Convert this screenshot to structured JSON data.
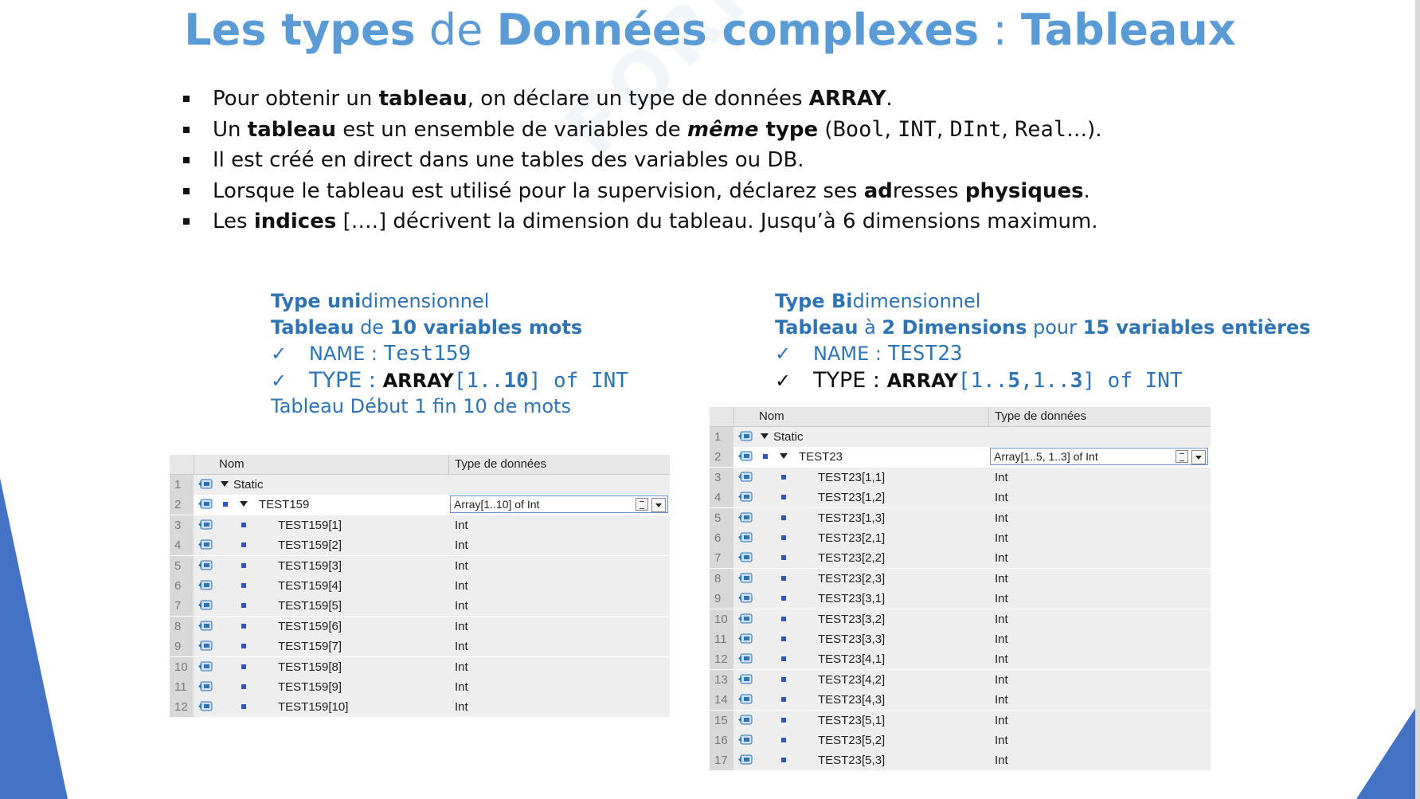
{
  "colors": {
    "title_blue": "#5b9bd5",
    "section_blue": "#2e74b5",
    "decor_blue": "#4472c4"
  },
  "title": {
    "part1": "Les types",
    "part2": " de ",
    "part3": "Données complexes",
    "part4": " : ",
    "part5": "Tableaux"
  },
  "bullets": {
    "b1": {
      "t1": "Pour obtenir un ",
      "t2": "tableau",
      "t3": ", on déclare un type de données ",
      "t4": "ARRAY",
      "t5": "."
    },
    "b2": {
      "t1": "Un ",
      "t2": "tableau",
      "t3": " est un ensemble de variables de ",
      "t4": "même",
      "t5": " type",
      "t6": " (",
      "t7": "Bool",
      "t8": ", ",
      "t9": "INT",
      "t10": ", ",
      "t11": "DInt",
      "t12": ", ",
      "t13": "Real",
      "t14": "…)."
    },
    "b3": {
      "t1": "Il est créé en direct dans une tables des variables ou DB."
    },
    "b4": {
      "t1": "Lorsque le tableau est utilisé pour la supervision, déclarez ses ",
      "t2": "ad",
      "t3": "resses ",
      "t4": "physiques",
      "t5": "."
    },
    "b5": {
      "t1": "Les ",
      "t2": "indices",
      "t3": " [….] décrivent la dimension du tableau. Jusqu’à 6 dimensions maximum."
    }
  },
  "uni": {
    "l1a": "Type uni",
    "l1b": "dimensionnel",
    "l2a": "Tableau",
    "l2b": " de ",
    "l2c": "10 variables mots",
    "check": "✓",
    "name_label": "NAME : ",
    "name_value": "Test159",
    "type_label": "TYPE : ",
    "type_kw": "ARRAY",
    "type_v1": "[1..",
    "type_v2": "10",
    "type_v3": "] of INT",
    "note": "Tableau Début 1 fin 10 de mots"
  },
  "bi": {
    "l1a": "Type Bi",
    "l1b": "dimensionnel",
    "l2a": "Tableau",
    "l2b": " à ",
    "l2c": "2 Dimensions",
    "l2d": " pour ",
    "l2e": "15 variables entières",
    "check": "✓",
    "name_label": "NAME : ",
    "name_value": "TEST23",
    "type_label": "TYPE : ",
    "type_kw": "ARRAY",
    "type_v1": "[1..",
    "type_v2": "5",
    "type_v3": ",1..",
    "type_v4": "3",
    "type_v5": "] of INT"
  },
  "grid1": {
    "col_name": "Nom",
    "col_type": "Type de données",
    "rows": [
      {
        "n": "1",
        "name": "Static",
        "type": ""
      },
      {
        "n": "2",
        "name": "TEST159",
        "type": "Array[1..10] of Int"
      },
      {
        "n": "3",
        "name": "TEST159[1]",
        "type": "Int"
      },
      {
        "n": "4",
        "name": "TEST159[2]",
        "type": "Int"
      },
      {
        "n": "5",
        "name": "TEST159[3]",
        "type": "Int"
      },
      {
        "n": "6",
        "name": "TEST159[4]",
        "type": "Int"
      },
      {
        "n": "7",
        "name": "TEST159[5]",
        "type": "Int"
      },
      {
        "n": "8",
        "name": "TEST159[6]",
        "type": "Int"
      },
      {
        "n": "9",
        "name": "TEST159[7]",
        "type": "Int"
      },
      {
        "n": "10",
        "name": "TEST159[8]",
        "type": "Int"
      },
      {
        "n": "11",
        "name": "TEST159[9]",
        "type": "Int"
      },
      {
        "n": "12",
        "name": "TEST159[10]",
        "type": "Int"
      }
    ]
  },
  "grid2": {
    "col_name": "Nom",
    "col_type": "Type de données",
    "rows": [
      {
        "n": "1",
        "name": "Static",
        "type": ""
      },
      {
        "n": "2",
        "name": "TEST23",
        "type": "Array[1..5, 1..3] of Int"
      },
      {
        "n": "3",
        "name": "TEST23[1,1]",
        "type": "Int"
      },
      {
        "n": "4",
        "name": "TEST23[1,2]",
        "type": "Int"
      },
      {
        "n": "5",
        "name": "TEST23[1,3]",
        "type": "Int"
      },
      {
        "n": "6",
        "name": "TEST23[2,1]",
        "type": "Int"
      },
      {
        "n": "7",
        "name": "TEST23[2,2]",
        "type": "Int"
      },
      {
        "n": "8",
        "name": "TEST23[2,3]",
        "type": "Int"
      },
      {
        "n": "9",
        "name": "TEST23[3,1]",
        "type": "Int"
      },
      {
        "n": "10",
        "name": "TEST23[3,2]",
        "type": "Int"
      },
      {
        "n": "11",
        "name": "TEST23[3,3]",
        "type": "Int"
      },
      {
        "n": "12",
        "name": "TEST23[4,1]",
        "type": "Int"
      },
      {
        "n": "13",
        "name": "TEST23[4,2]",
        "type": "Int"
      },
      {
        "n": "14",
        "name": "TEST23[4,3]",
        "type": "Int"
      },
      {
        "n": "15",
        "name": "TEST23[5,1]",
        "type": "Int"
      },
      {
        "n": "16",
        "name": "TEST23[5,2]",
        "type": "Int"
      },
      {
        "n": "17",
        "name": "TEST23[5,3]",
        "type": "Int"
      }
    ]
  }
}
